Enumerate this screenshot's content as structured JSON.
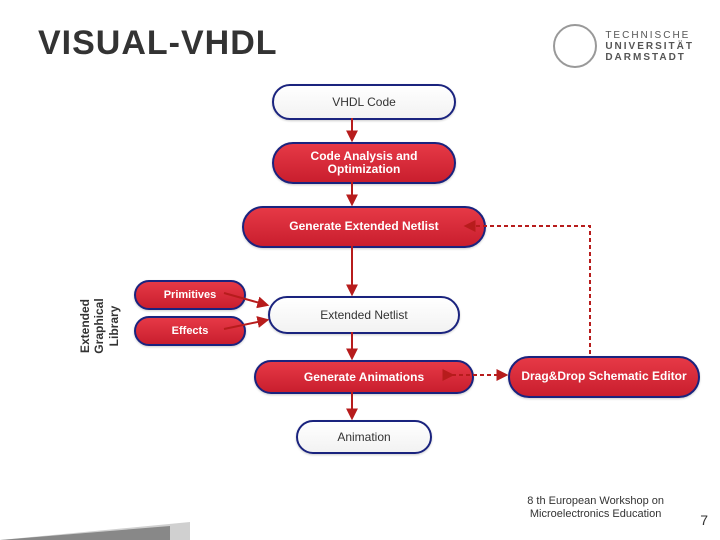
{
  "title": "VISUAL-VHDL",
  "university": {
    "t": "TECHNISCHE",
    "u1": "UNIVERSITÄT",
    "u2": "DARMSTADT"
  },
  "nodes": {
    "vhdl": "VHDL Code",
    "analysis": "Code Analysis and Optimization",
    "generate": "Generate Extended Netlist",
    "primitives": "Primitives",
    "effects": "Effects",
    "netlist": "Extended Netlist",
    "animations": "Generate Animations",
    "animation": "Animation",
    "editor": "Drag&Drop Schematic Editor"
  },
  "library_label": "Extended Graphical Library",
  "footer": {
    "l1": "8 th European Workshop on",
    "l2": "Microelectronics Education"
  },
  "page": "7"
}
